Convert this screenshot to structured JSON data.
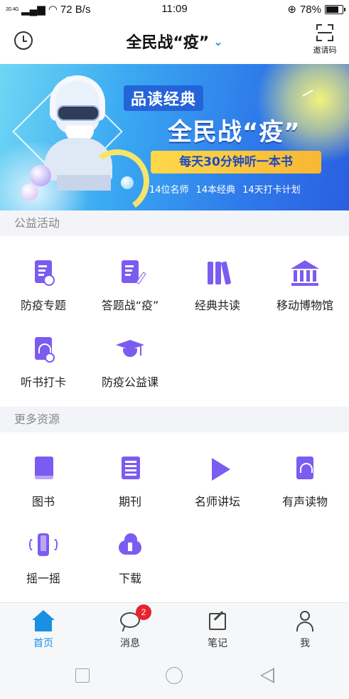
{
  "status_bar": {
    "network": "2G 4G",
    "speed": "72 B/s",
    "time": "11:09",
    "battery": "78%",
    "battery_level": 0.78
  },
  "header": {
    "title": "全民战“疫”",
    "invite_label": "邀请码"
  },
  "banner": {
    "tag": "品读经典",
    "title": "全民战“疫”",
    "slogan": "每天30分钟听一本书",
    "info": [
      "14位名师",
      "14本经典",
      "14天打卡计划"
    ]
  },
  "sections": {
    "public_welfare": {
      "title": "公益活动",
      "items": [
        {
          "label": "防疫专题",
          "icon": "document-shield-icon"
        },
        {
          "label": "答题战“疫”",
          "icon": "document-pen-icon"
        },
        {
          "label": "经典共读",
          "icon": "books-icon"
        },
        {
          "label": "移动博物馆",
          "icon": "museum-icon"
        },
        {
          "label": "听书打卡",
          "icon": "headphone-book-icon"
        },
        {
          "label": "防疫公益课",
          "icon": "graduation-cap-icon"
        }
      ]
    },
    "more_resources": {
      "title": "更多资源",
      "items": [
        {
          "label": "图书",
          "icon": "book-icon"
        },
        {
          "label": "期刊",
          "icon": "journal-icon"
        },
        {
          "label": "名师讲坛",
          "icon": "play-icon"
        },
        {
          "label": "有声读物",
          "icon": "audiobook-icon"
        },
        {
          "label": "摇一摇",
          "icon": "shake-phone-icon"
        },
        {
          "label": "下载",
          "icon": "cloud-download-icon"
        }
      ]
    }
  },
  "tabbar": {
    "tabs": [
      {
        "label": "首页",
        "icon": "home-icon",
        "active": true
      },
      {
        "label": "消息",
        "icon": "message-icon",
        "badge": "2"
      },
      {
        "label": "笔记",
        "icon": "note-icon"
      },
      {
        "label": "我",
        "icon": "person-icon"
      }
    ]
  },
  "colors": {
    "accent": "#1a8fe3",
    "icon_purple": "#7b5cf0",
    "badge_red": "#e8232e",
    "section_bg": "#f2f4f7"
  }
}
